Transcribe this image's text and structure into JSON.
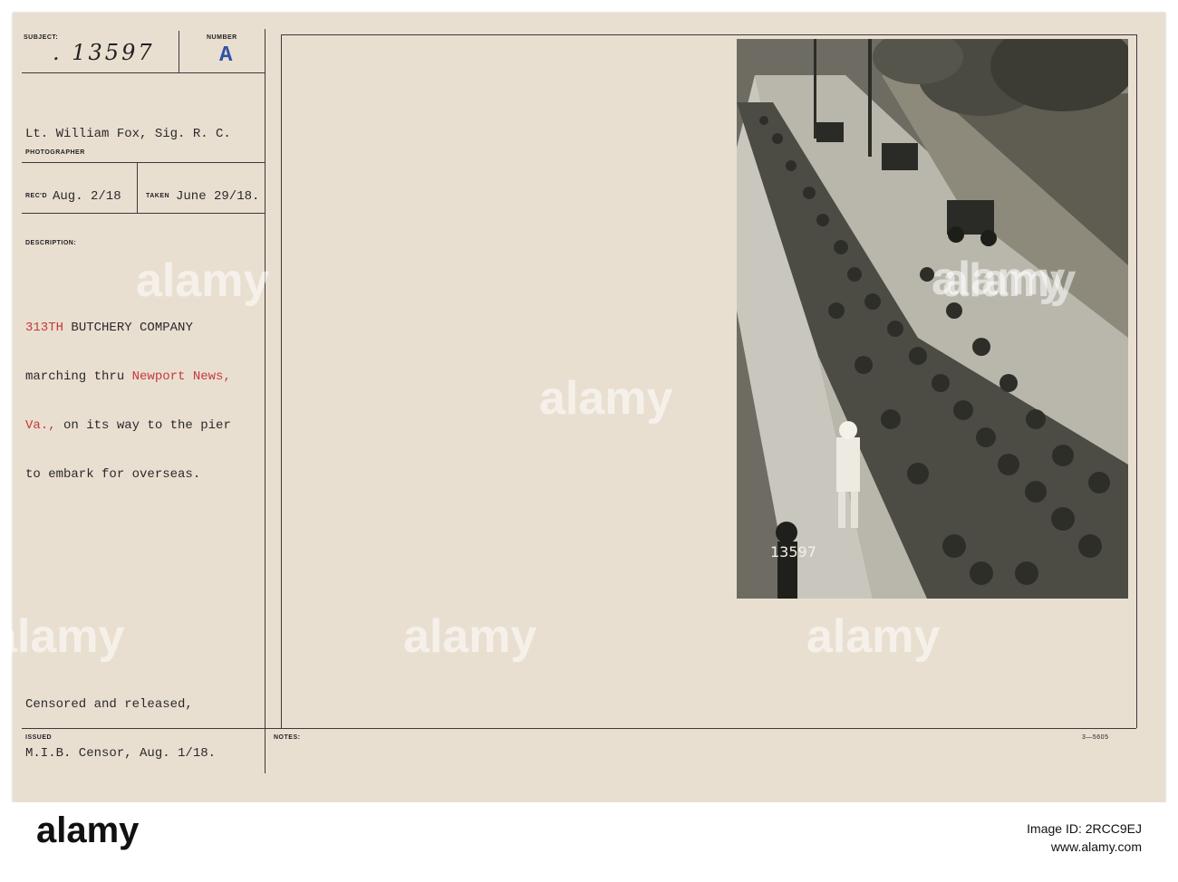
{
  "card": {
    "labels": {
      "subject": "SUBJECT:",
      "number": "NUMBER",
      "photographer": "PHOTOGRAPHER",
      "recd": "REC'D",
      "taken": "TAKEN",
      "description": "DESCRIPTION:",
      "issued": "ISSUED",
      "notes": "NOTES:"
    },
    "subject_number": ". 13597",
    "number_letter": "A",
    "photographer_name": "Lt. William Fox, Sig. R. C.",
    "recd_date": "Aug. 2/18",
    "taken_date": "June 29/18.",
    "description": {
      "line1_red": "313TH",
      "line1_rest": " BUTCHERY COMPANY",
      "line2_start": "marching thru ",
      "line2_red": "Newport News,",
      "line3_red": "Va.,",
      "line3_rest": " on its way to the pier",
      "line4": "to embark for overseas."
    },
    "censor_line1": "Censored and released,",
    "censor_line2": "M.I.B. Censor, Aug. 1/18.",
    "form_number": "3—5605"
  },
  "photo": {
    "caption_number": "13597"
  },
  "watermark": {
    "text": "alamy"
  },
  "footer": {
    "logo": "alamy",
    "image_id_label": "Image ID: 2RCC9EJ",
    "site": "www.alamy.com"
  }
}
